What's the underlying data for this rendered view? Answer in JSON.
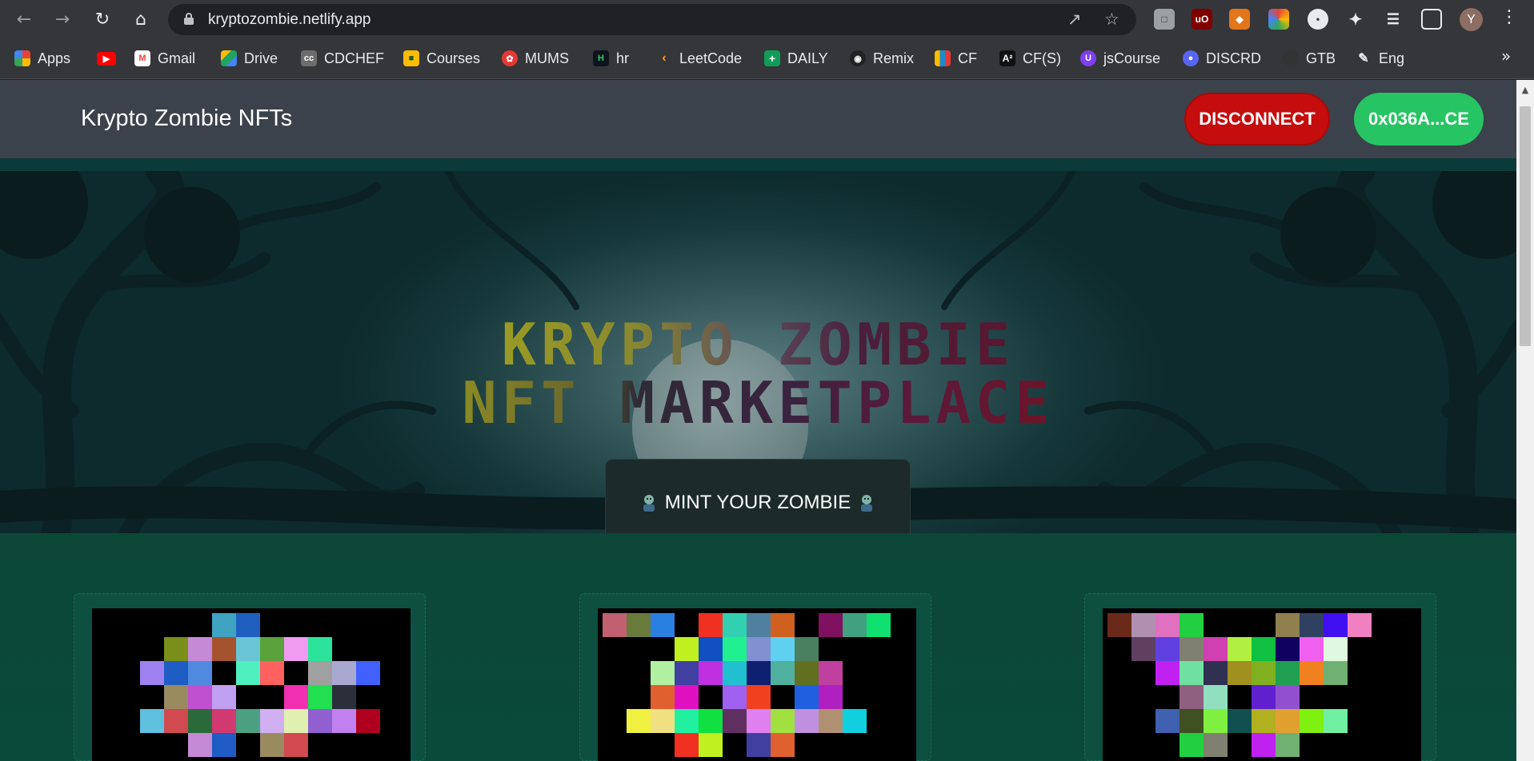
{
  "browser": {
    "url": "kryptozombie.netlify.app",
    "avatar_letter": "Y",
    "bookmarks": [
      {
        "label": "Apps",
        "color": "#ea4335"
      },
      {
        "label": "",
        "color": "#ff0000"
      },
      {
        "label": "Gmail",
        "color": "#ea4335"
      },
      {
        "label": "Drive",
        "color": "#1fa463"
      },
      {
        "label": "CDCHEF",
        "color": "#6d6d6d"
      },
      {
        "label": "Courses",
        "color": "#fbbc04"
      },
      {
        "label": "MUMS",
        "color": "#e53935"
      },
      {
        "label": "hr",
        "color": "#0e141e"
      },
      {
        "label": "LeetCode",
        "color": "#ffa116"
      },
      {
        "label": "DAILY",
        "color": "#0f9d58"
      },
      {
        "label": "Remix",
        "color": "#222"
      },
      {
        "label": "CF",
        "color": "#1f8acb"
      },
      {
        "label": "CF(S)",
        "color": "#111"
      },
      {
        "label": "jsCourse",
        "color": "#7e3ff2"
      },
      {
        "label": "DISCRD",
        "color": "#5865f2"
      },
      {
        "label": "GTB",
        "color": "#333"
      },
      {
        "label": "Eng",
        "color": "#555"
      }
    ]
  },
  "app": {
    "title": "Krypto Zombie NFTs",
    "disconnect_label": "DISCONNECT",
    "address_label": "0x036A...CE",
    "hero_line1": "KRYPTO ZOMBIE",
    "hero_line2": "NFT MARKETPLACE",
    "mint_label": "MINT YOUR ZOMBIE",
    "colors": {
      "appbar": "#3b424b",
      "disconnect": "#c50d0d",
      "address": "#27c463",
      "gallery": "#0a4a3a"
    }
  }
}
